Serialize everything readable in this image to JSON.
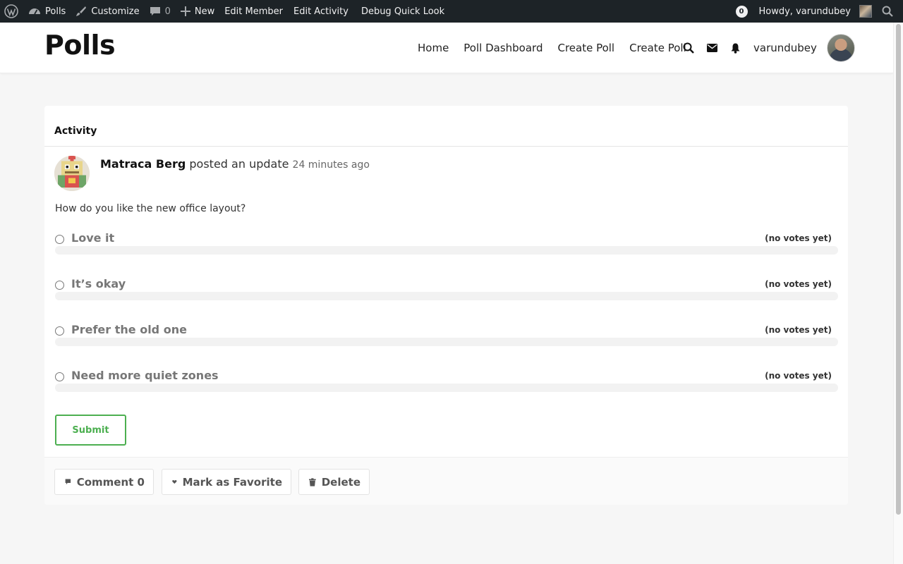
{
  "admin_bar": {
    "items": [
      {
        "icon": "wordpress-logo-icon",
        "label": ""
      },
      {
        "icon": "dashboard-icon",
        "label": "Polls"
      },
      {
        "icon": "brush-icon",
        "label": "Customize"
      },
      {
        "icon": "comment-bubble-icon",
        "label": "0"
      },
      {
        "icon": "plus-icon",
        "label": "New"
      },
      {
        "icon": "",
        "label": "Edit Member"
      },
      {
        "icon": "",
        "label": "Edit Activity"
      },
      {
        "icon": "",
        "label": "Debug Quick Look"
      }
    ],
    "notification_count": "0",
    "howdy": "Howdy, varundubey"
  },
  "header": {
    "site_title": "Polls",
    "nav": [
      "Home",
      "Poll Dashboard",
      "Create Poll",
      "Create Poll"
    ],
    "username": "varundubey"
  },
  "activity": {
    "title": "Activity",
    "author": "Matraca Berg",
    "action": "posted an update",
    "time": "24 minutes ago",
    "question": "How do you like the new office layout?",
    "options": [
      {
        "label": "Love it",
        "votes": "(no votes yet)",
        "fraction": 0
      },
      {
        "label": "It’s okay",
        "votes": "(no votes yet)",
        "fraction": 0
      },
      {
        "label": "Prefer the old one",
        "votes": "(no votes yet)",
        "fraction": 0
      },
      {
        "label": "Need more quiet zones",
        "votes": "(no votes yet)",
        "fraction": 0
      }
    ],
    "submit_label": "Submit",
    "actions": {
      "comment": "Comment 0",
      "favorite": "Mark as Favorite",
      "delete": "Delete"
    }
  },
  "colors": {
    "admin_bar_bg": "#1d2327",
    "accent_green": "#4caf50",
    "page_bg": "#f6f6f6"
  }
}
